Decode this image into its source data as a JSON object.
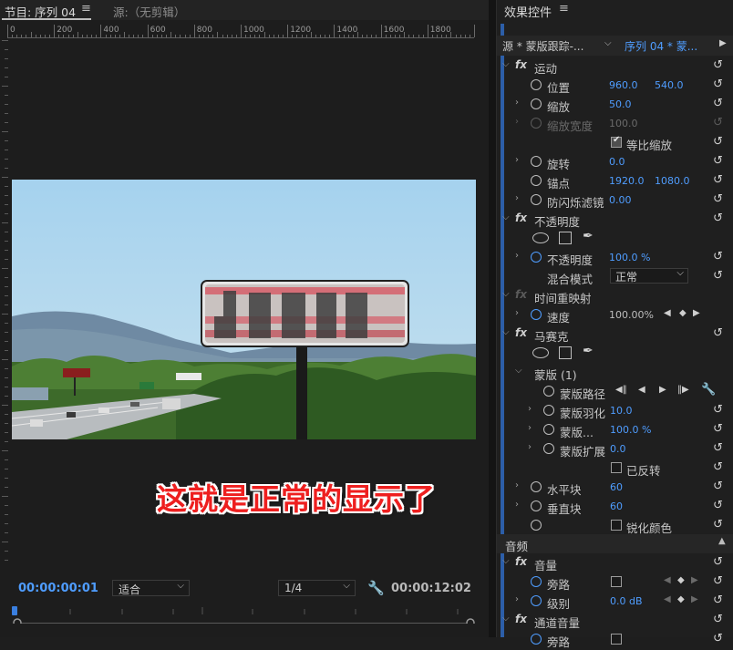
{
  "program": {
    "tab_label": "节目: 序列 04",
    "tab_menu": "≡",
    "source_tab": "源:（无剪辑）",
    "ruler_labels": [
      "0",
      "200",
      "400",
      "600",
      "800",
      "1000",
      "1200",
      "1400",
      "1600",
      "1800"
    ],
    "billboard_text": "JESUS",
    "caption": "这就是正常的显示了",
    "timecode_left": "00:00:00:01",
    "fit_label": "适合",
    "resolution_label": "1/4",
    "timecode_right": "00:00:12:02"
  },
  "effects": {
    "title": "效果控件",
    "menu": "≡",
    "source_label": "源 * 蒙版跟踪-...",
    "seq_label": "序列 04 * 蒙...",
    "motion": {
      "label": "运动",
      "position_label": "位置",
      "position_x": "960.0",
      "position_y": "540.0",
      "scale_label": "缩放",
      "scale_value": "50.0",
      "scale_width_label": "缩放宽度",
      "scale_width_value": "100.0",
      "uniform_label": "等比缩放",
      "rotation_label": "旋转",
      "rotation_value": "0.0",
      "anchor_label": "锚点",
      "anchor_x": "1920.0",
      "anchor_y": "1080.0",
      "antiflicker_label": "防闪烁滤镜",
      "antiflicker_value": "0.00"
    },
    "opacity": {
      "label": "不透明度",
      "value_label": "不透明度",
      "value": "100.0 %",
      "blend_label": "混合模式",
      "blend_value": "正常"
    },
    "time_remap": {
      "label": "时间重映射",
      "speed_label": "速度",
      "speed_value": "100.00%"
    },
    "mosaic": {
      "label": "马赛克",
      "mask_label": "蒙版 (1)",
      "path_label": "蒙版路径",
      "feather_label": "蒙版羽化",
      "feather_value": "10.0",
      "opacity_label": "蒙版...",
      "opacity_value": "100.0 %",
      "expansion_label": "蒙版扩展",
      "expansion_value": "0.0",
      "inverted_label": "已反转",
      "horizontal_label": "水平块",
      "horizontal_value": "60",
      "vertical_label": "垂直块",
      "vertical_value": "60",
      "sharpen_label": "锐化颜色"
    },
    "audio": {
      "section_label": "音频",
      "volume_label": "音量",
      "bypass_label": "旁路",
      "level_label": "级别",
      "level_value": "0.0 dB",
      "channel_volume_label": "通道音量",
      "channel_sub_label": "旁路"
    }
  }
}
